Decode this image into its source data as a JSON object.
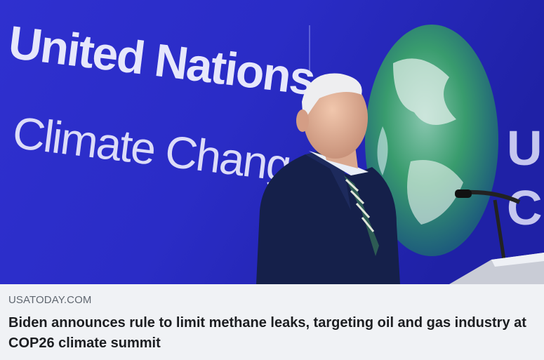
{
  "link_preview": {
    "image": {
      "alt": "Biden speaking at United Nations Climate Change conference",
      "banner_line1": "United Nations",
      "banner_line2": "Climate Change",
      "background_color": "#2b2fc4"
    },
    "domain": "USATODAY.COM",
    "headline": "Biden announces rule to limit methane leaks, targeting oil and gas industry at COP26 climate summit"
  }
}
